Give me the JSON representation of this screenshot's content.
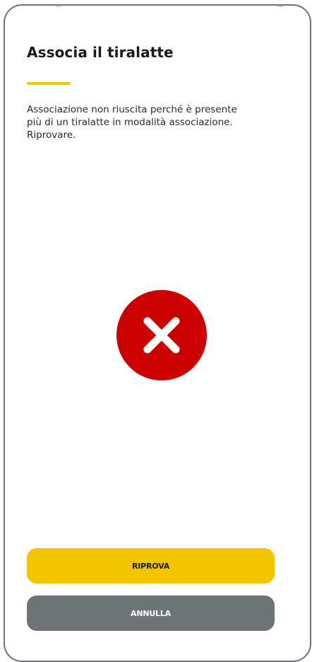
{
  "screen": {
    "title": "Associa il tiralatte",
    "message": "Associazione non riuscita perché è presente\npiù di un tiralatte in modalità associazione.\nRiprovare.",
    "status_icon": "error-x-icon",
    "retry_label": "RIPROVA",
    "cancel_label": "ANNULLA"
  },
  "colors": {
    "accent": "#f5c400",
    "error": "#cc0000",
    "secondary_button": "#6e7476",
    "frame": "#6d7378"
  }
}
